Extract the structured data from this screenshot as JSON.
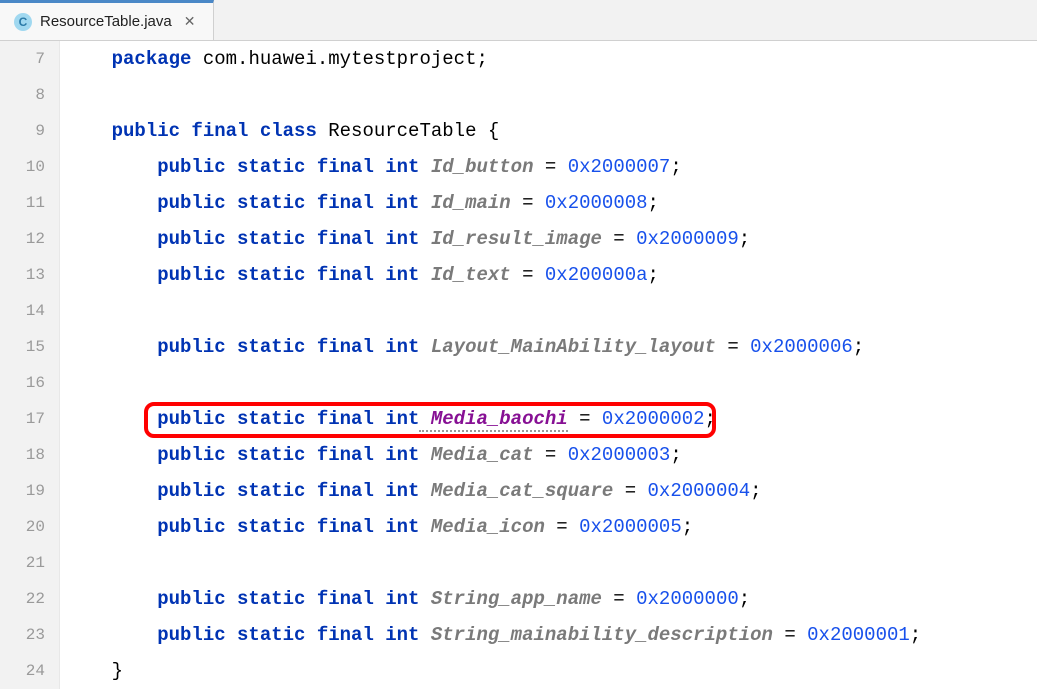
{
  "tab": {
    "filename": "ResourceTable.java",
    "icon_letter": "C"
  },
  "gutter": [
    "7",
    "8",
    "9",
    "10",
    "11",
    "12",
    "13",
    "14",
    "15",
    "16",
    "17",
    "18",
    "19",
    "20",
    "21",
    "22",
    "23",
    "24"
  ],
  "code": {
    "l7": {
      "kw": "package",
      "rest": " com.huawei.mytestproject;"
    },
    "l9": {
      "kw1": "public final class",
      "cls": " ResourceTable ",
      "brace": "{"
    },
    "l10": {
      "kw": "public static final int",
      "fld": " Id_button",
      "eq": " = ",
      "val": "0x2000007",
      "semi": ";"
    },
    "l11": {
      "kw": "public static final int",
      "fld": " Id_main",
      "eq": " = ",
      "val": "0x2000008",
      "semi": ";"
    },
    "l12": {
      "kw": "public static final int",
      "fld": " Id_result_image",
      "eq": " = ",
      "val": "0x2000009",
      "semi": ";"
    },
    "l13": {
      "kw": "public static final int",
      "fld": " Id_text",
      "eq": " = ",
      "val": "0x200000a",
      "semi": ";"
    },
    "l15": {
      "kw": "public static final int",
      "fld": " Layout_MainAbility_layout",
      "eq": " = ",
      "val": "0x2000006",
      "semi": ";"
    },
    "l17": {
      "kw": "public static final int",
      "fld": " Media_baochi",
      "eq": " = ",
      "val": "0x2000002",
      "semi": ";"
    },
    "l18": {
      "kw": "public static final int",
      "fld": " Media_cat",
      "eq": " = ",
      "val": "0x2000003",
      "semi": ";"
    },
    "l19": {
      "kw": "public static final int",
      "fld": " Media_cat_square",
      "eq": " = ",
      "val": "0x2000004",
      "semi": ";"
    },
    "l20": {
      "kw": "public static final int",
      "fld": " Media_icon",
      "eq": " = ",
      "val": "0x2000005",
      "semi": ";"
    },
    "l22": {
      "kw": "public static final int",
      "fld": " String_app_name",
      "eq": " = ",
      "val": "0x2000000",
      "semi": ";"
    },
    "l23": {
      "kw": "public static final int",
      "fld": " String_mainability_description",
      "eq": " = ",
      "val": "0x2000001",
      "semi": ";"
    },
    "l24": {
      "brace": "}"
    }
  }
}
